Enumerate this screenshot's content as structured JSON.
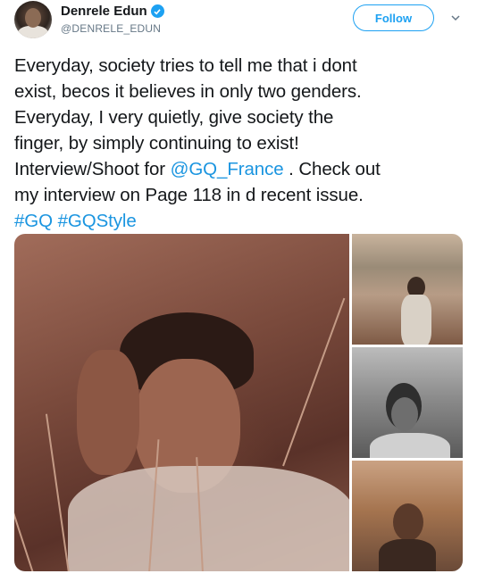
{
  "user": {
    "display_name": "Denrele Edun",
    "handle": "@DENRELE_EDUN",
    "verified": true
  },
  "actions": {
    "follow_label": "Follow",
    "menu_icon": "chevron-down-icon"
  },
  "tweet": {
    "lines": [
      "Everyday, society tries to tell me that i dont",
      "exist, becos it believes in only two genders.",
      "Everyday, I very quietly, give society the",
      "finger, by simply continuing to exist!",
      "Interview/Shoot for ",
      "my interview on Page 118 in d recent issue."
    ],
    "mention": "@GQ_France",
    "after_mention": " . Check out",
    "hashtags": "#GQ #GQStyle"
  },
  "colors": {
    "accent": "#1da1f2",
    "link": "#1b95e0",
    "text": "#14171a",
    "secondary": "#657786"
  }
}
